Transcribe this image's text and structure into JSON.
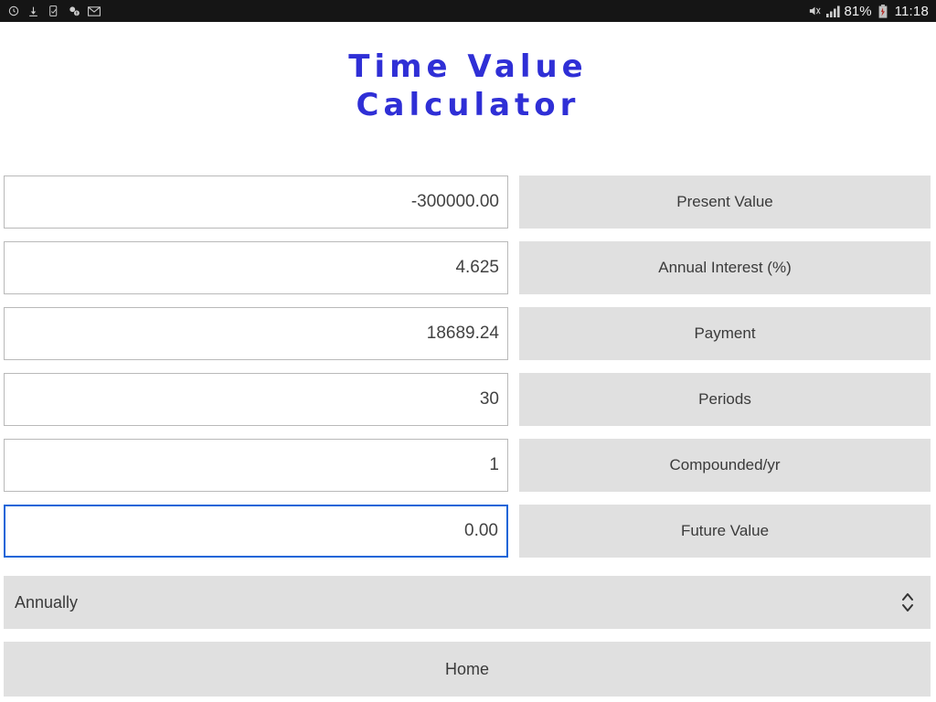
{
  "statusbar": {
    "left_icons": [
      {
        "name": "alarm-clock-icon"
      },
      {
        "name": "download-icon"
      },
      {
        "name": "phone-check-icon"
      },
      {
        "name": "contacts-alert-icon"
      },
      {
        "name": "email-icon"
      }
    ],
    "right_icons": [
      {
        "name": "mute-icon"
      },
      {
        "name": "signal-bars-icon"
      },
      {
        "name": "battery-icon"
      }
    ],
    "battery_percent": "81%",
    "clock": "11:18"
  },
  "header": {
    "title_line1": "Time Value",
    "title_line2": "Calculator",
    "title_color": "#2f2fd6"
  },
  "form": {
    "rows": [
      {
        "value": "-300000.00",
        "label": "Present Value",
        "focused": false
      },
      {
        "value": "4.625",
        "label": "Annual Interest (%)",
        "focused": false
      },
      {
        "value": "18689.24",
        "label": "Payment",
        "focused": false
      },
      {
        "value": "30",
        "label": "Periods",
        "focused": false
      },
      {
        "value": "1",
        "label": "Compounded/yr",
        "focused": false
      },
      {
        "value": "0.00",
        "label": "Future Value",
        "focused": true
      }
    ],
    "focus_color": "#1565d8"
  },
  "frequency_select": {
    "selected": "Annually",
    "stepper_icon": "chevron-up-down-icon"
  },
  "footer": {
    "home_label": "Home"
  }
}
